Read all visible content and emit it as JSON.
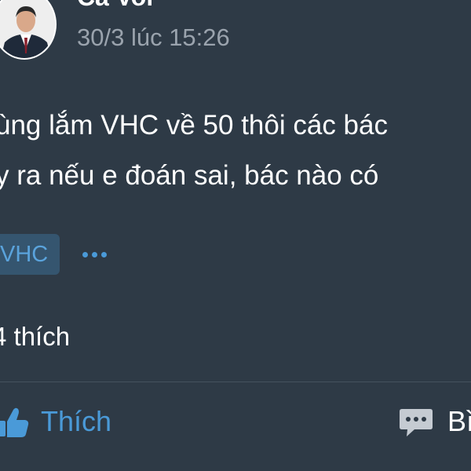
{
  "post": {
    "author": "Cá Voi",
    "timestamp": "30/3 lúc 15:26",
    "text_line1": "ùng lắm VHC về 50 thôi các bác",
    "text_line2": "y ra nếu e đoán sai, bác nào có",
    "tag": "VHC",
    "more_icon": "more-dots-icon"
  },
  "reactions": {
    "likes_text": "4 thích"
  },
  "actions": {
    "like_label": "Thích",
    "like_icon": "thumbs-up-icon",
    "comment_label": "Bì",
    "comment_icon": "comment-bubble-icon"
  },
  "colors": {
    "background": "#2e3a46",
    "accent": "#4a9ad8",
    "tag_background": "#35556f",
    "muted_text": "#9aa3ad"
  }
}
